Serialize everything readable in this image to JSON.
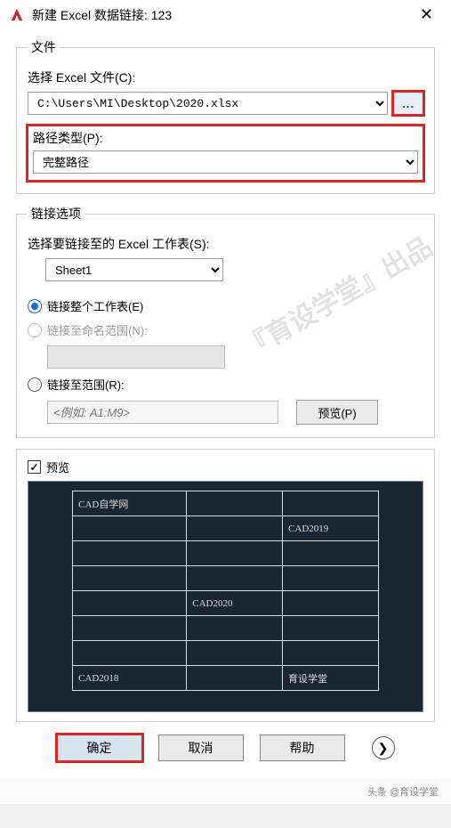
{
  "title": "新建 Excel 数据链接: 123",
  "file_section": {
    "legend": "文件",
    "select_label": "选择 Excel 文件(C):",
    "file_path": "C:\\Users\\MI\\Desktop\\2020.xlsx",
    "browse_label": "...",
    "path_type_label": "路径类型(P):",
    "path_type_value": "完整路径"
  },
  "link_section": {
    "legend": "链接选项",
    "sheet_label": "选择要链接至的 Excel 工作表(S):",
    "sheet_value": "Sheet1",
    "opt_whole": "链接整个工作表(E)",
    "opt_named": "链接至命名范围(N):",
    "opt_range": "链接至范围(R):",
    "range_placeholder": "<例如: A1:M9>",
    "preview_btn": "预览(P)"
  },
  "preview": {
    "checkbox_label": "预览",
    "table": [
      [
        "CAD自学网",
        "",
        ""
      ],
      [
        "",
        "",
        "CAD2019"
      ],
      [
        "",
        "",
        ""
      ],
      [
        "",
        "",
        ""
      ],
      [
        "",
        "CAD2020",
        ""
      ],
      [
        "",
        "",
        ""
      ],
      [
        "",
        "",
        ""
      ],
      [
        "CAD2018",
        "",
        "育设学堂"
      ]
    ]
  },
  "buttons": {
    "ok": "确定",
    "cancel": "取消",
    "help": "帮助"
  },
  "watermark_lines": [
    "『育设学堂』出品"
  ],
  "footer": "头条 @育设学堂"
}
